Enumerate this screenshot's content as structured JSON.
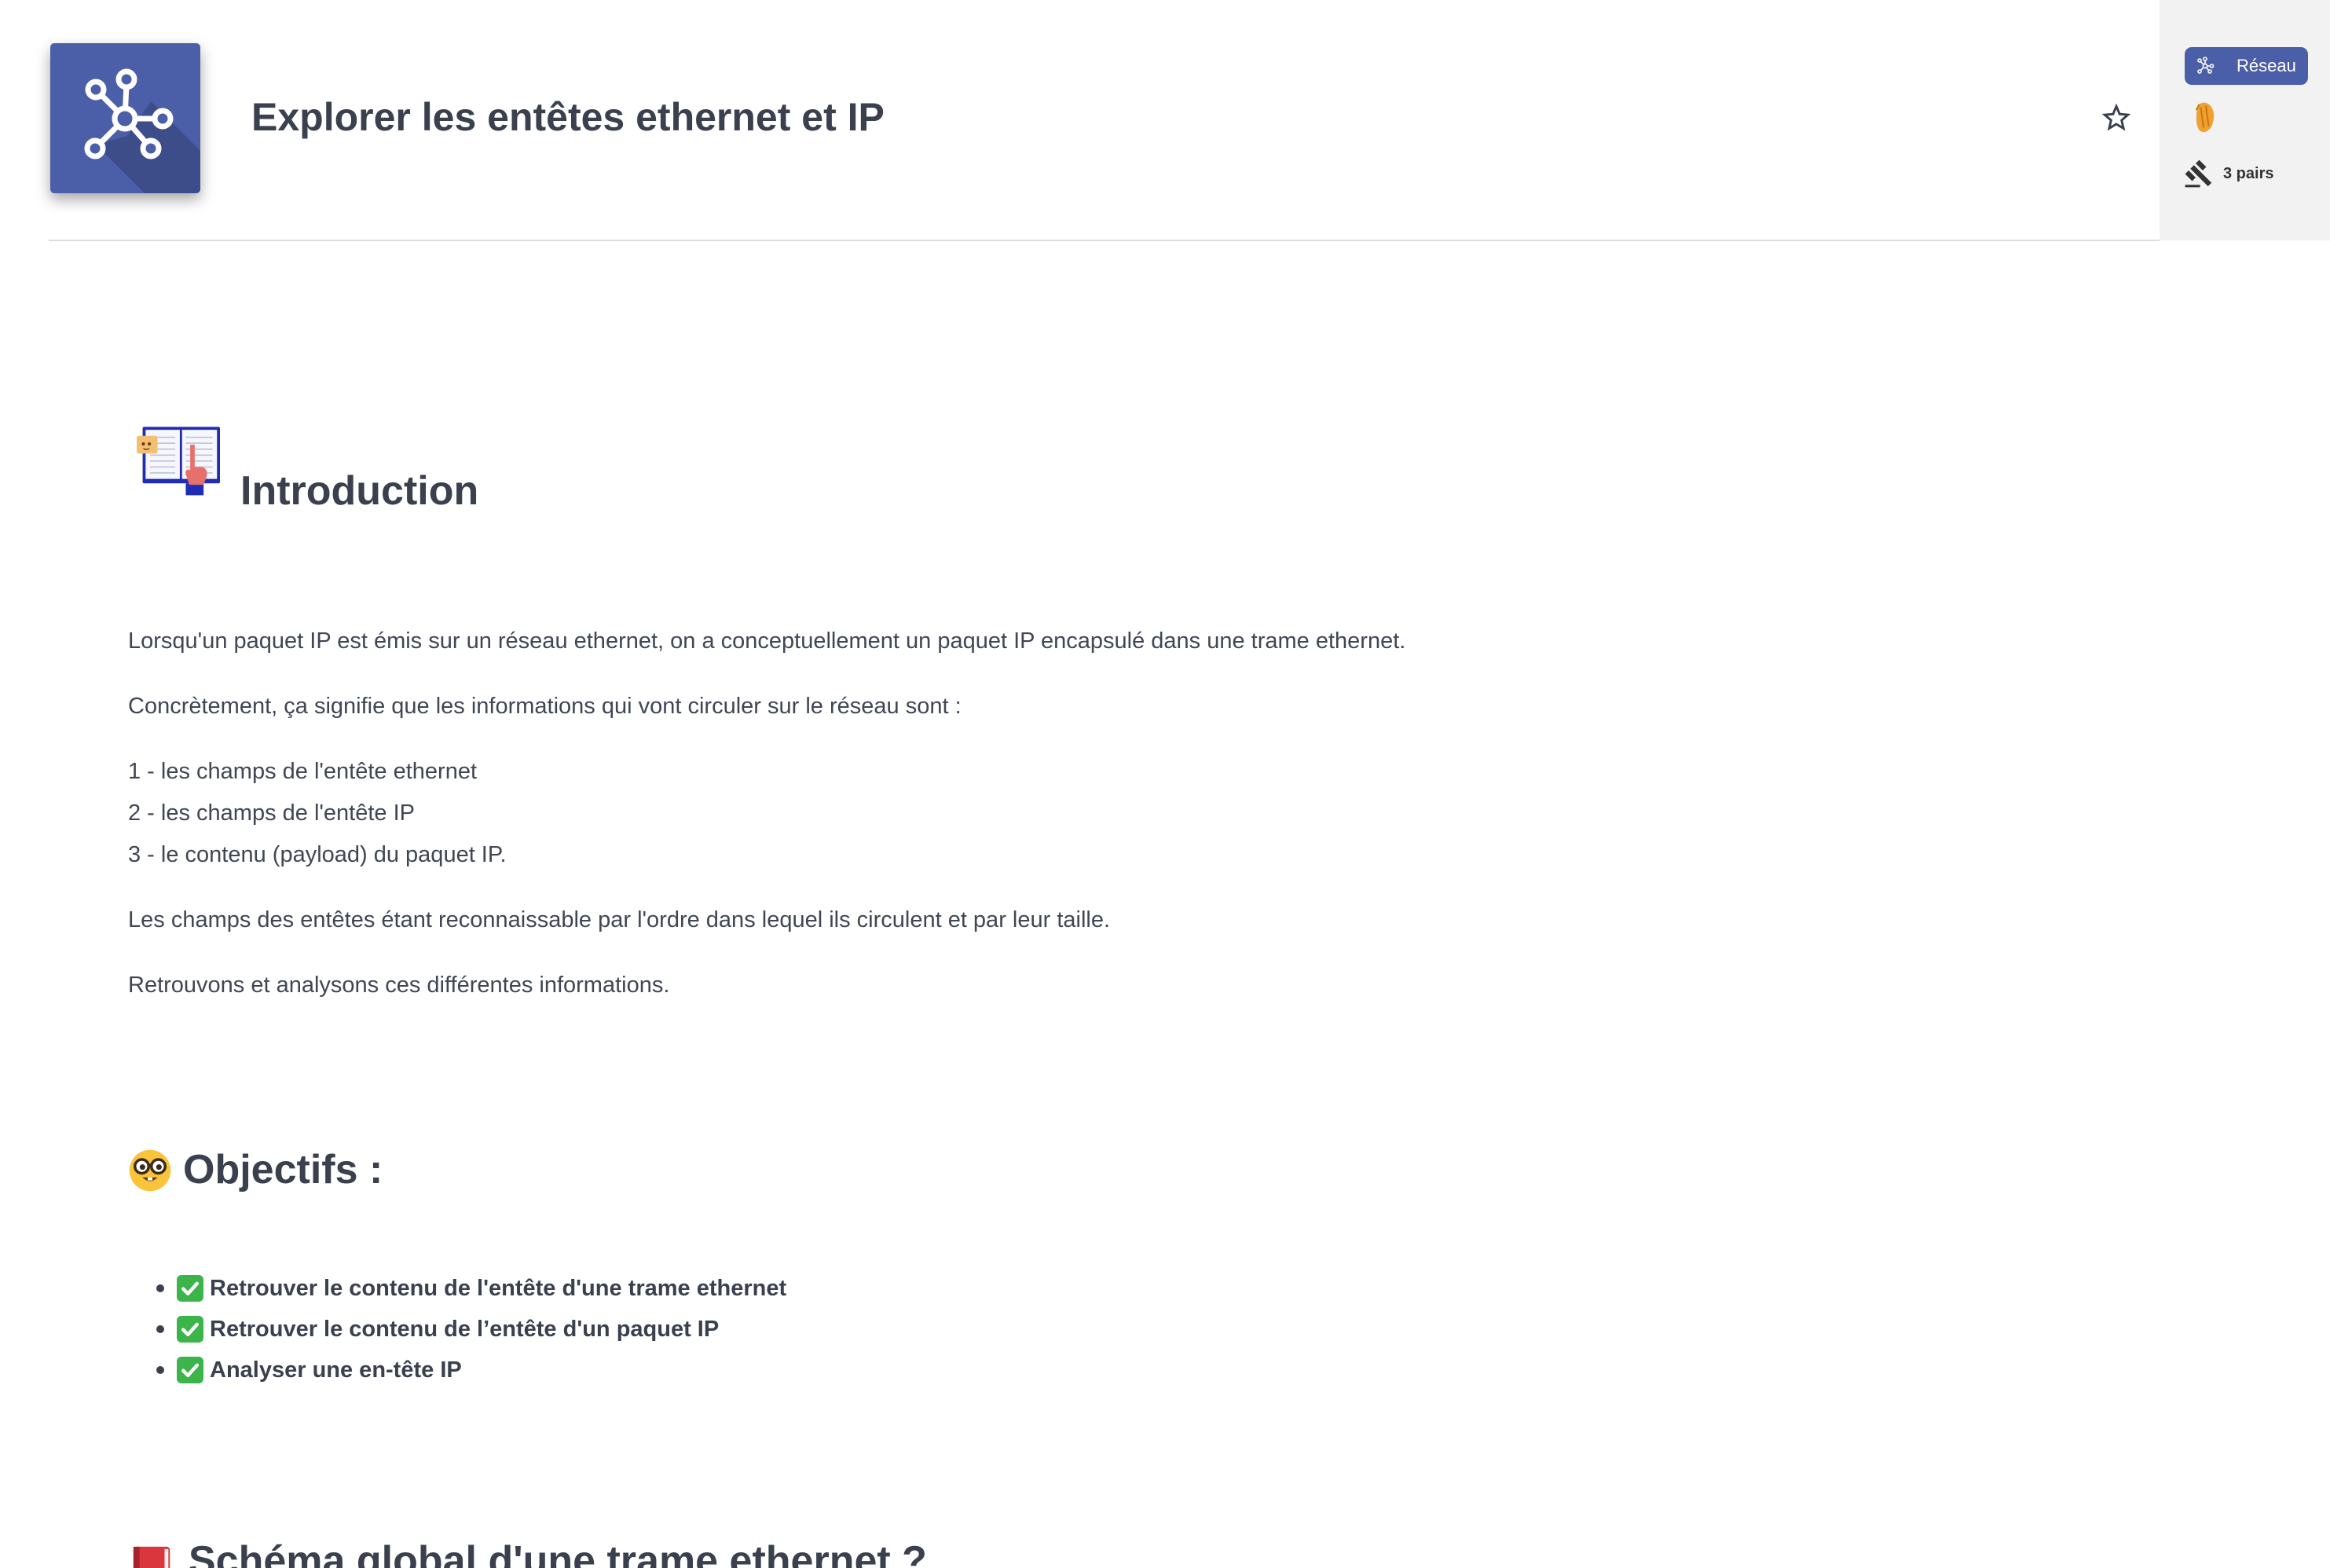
{
  "header": {
    "title": "Explorer les entêtes ethernet et IP",
    "logo_icon": "hub-icon",
    "favorite_icon": "star-outline-icon"
  },
  "sidebar": {
    "category_label": "Réseau",
    "category_icon": "hub-icon",
    "level_icon": "orange-level-icon",
    "peers_icon": "gavel-icon",
    "peers_label": "3 pairs"
  },
  "intro": {
    "icon": "open-book-icon",
    "heading": "Introduction",
    "p1": "Lorsqu'un paquet IP est émis sur un réseau ethernet, on a conceptuellement un paquet IP encapsulé dans une trame ethernet.",
    "p2": "Concrètement, ça signifie que les informations qui vont circuler sur le réseau sont :",
    "steps": [
      "1 - les champs de l'entête ethernet",
      "2 - les champs de l'entête IP",
      "3 - le contenu (payload) du paquet IP."
    ],
    "p3": "Les champs des entêtes étant reconnaissable par l'ordre dans lequel ils circulent et par leur taille.",
    "p4": "Retrouvons et analysons ces différentes informations."
  },
  "objectives": {
    "icon": "nerd-face-icon",
    "heading": "Objectifs :",
    "item_icon": "check-mark-icon",
    "items": [
      "Retrouver le contenu de l'entête d'une trame ethernet",
      "Retrouver le contenu de l’entête d'un paquet IP",
      "Analyser une en-tête IP"
    ]
  },
  "next_section": {
    "icon": "red-book-icon",
    "heading": "Schéma global d'une trame ethernet ?"
  },
  "colors": {
    "brand_blue": "#4b5ea8",
    "sidebar_bg": "#f2f2f2",
    "text": "#404654",
    "check_green": "#3bb54a",
    "level_orange": "#f0a030"
  }
}
